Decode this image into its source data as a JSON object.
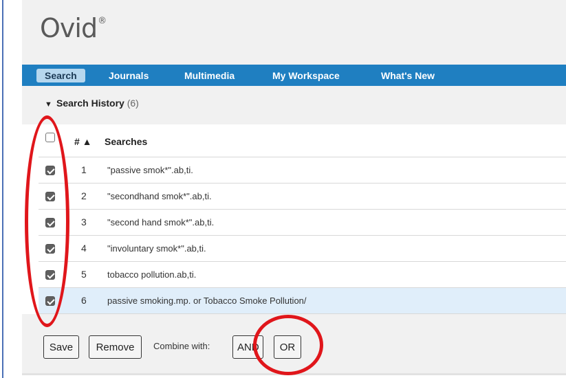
{
  "logo": {
    "text": "Ovid",
    "mark": "®"
  },
  "nav": {
    "items": [
      {
        "label": "Search",
        "active": true
      },
      {
        "label": "Journals"
      },
      {
        "label": "Multimedia"
      },
      {
        "label": "My Workspace"
      },
      {
        "label": "What's New"
      }
    ]
  },
  "history": {
    "title": "Search History",
    "count": "(6)",
    "columns": {
      "num": "# ▲",
      "searches": "Searches"
    },
    "rows": [
      {
        "num": "1",
        "query": "\"passive smok*\".ab,ti.",
        "checked": true
      },
      {
        "num": "2",
        "query": "\"secondhand smok*\".ab,ti.",
        "checked": true
      },
      {
        "num": "3",
        "query": "\"second hand smok*\".ab,ti.",
        "checked": true
      },
      {
        "num": "4",
        "query": "\"involuntary smok*\".ab,ti.",
        "checked": true
      },
      {
        "num": "5",
        "query": "tobacco pollution.ab,ti.",
        "checked": true
      },
      {
        "num": "6",
        "query": "passive smoking.mp. or Tobacco Smoke Pollution/",
        "checked": true,
        "selected": true
      }
    ]
  },
  "actions": {
    "save": "Save",
    "remove": "Remove",
    "combine_label": "Combine with:",
    "and": "AND",
    "or": "OR"
  },
  "colors": {
    "nav_bg": "#1f7fc1",
    "annotation": "#e0161b",
    "selected_row": "#e0eefa"
  }
}
